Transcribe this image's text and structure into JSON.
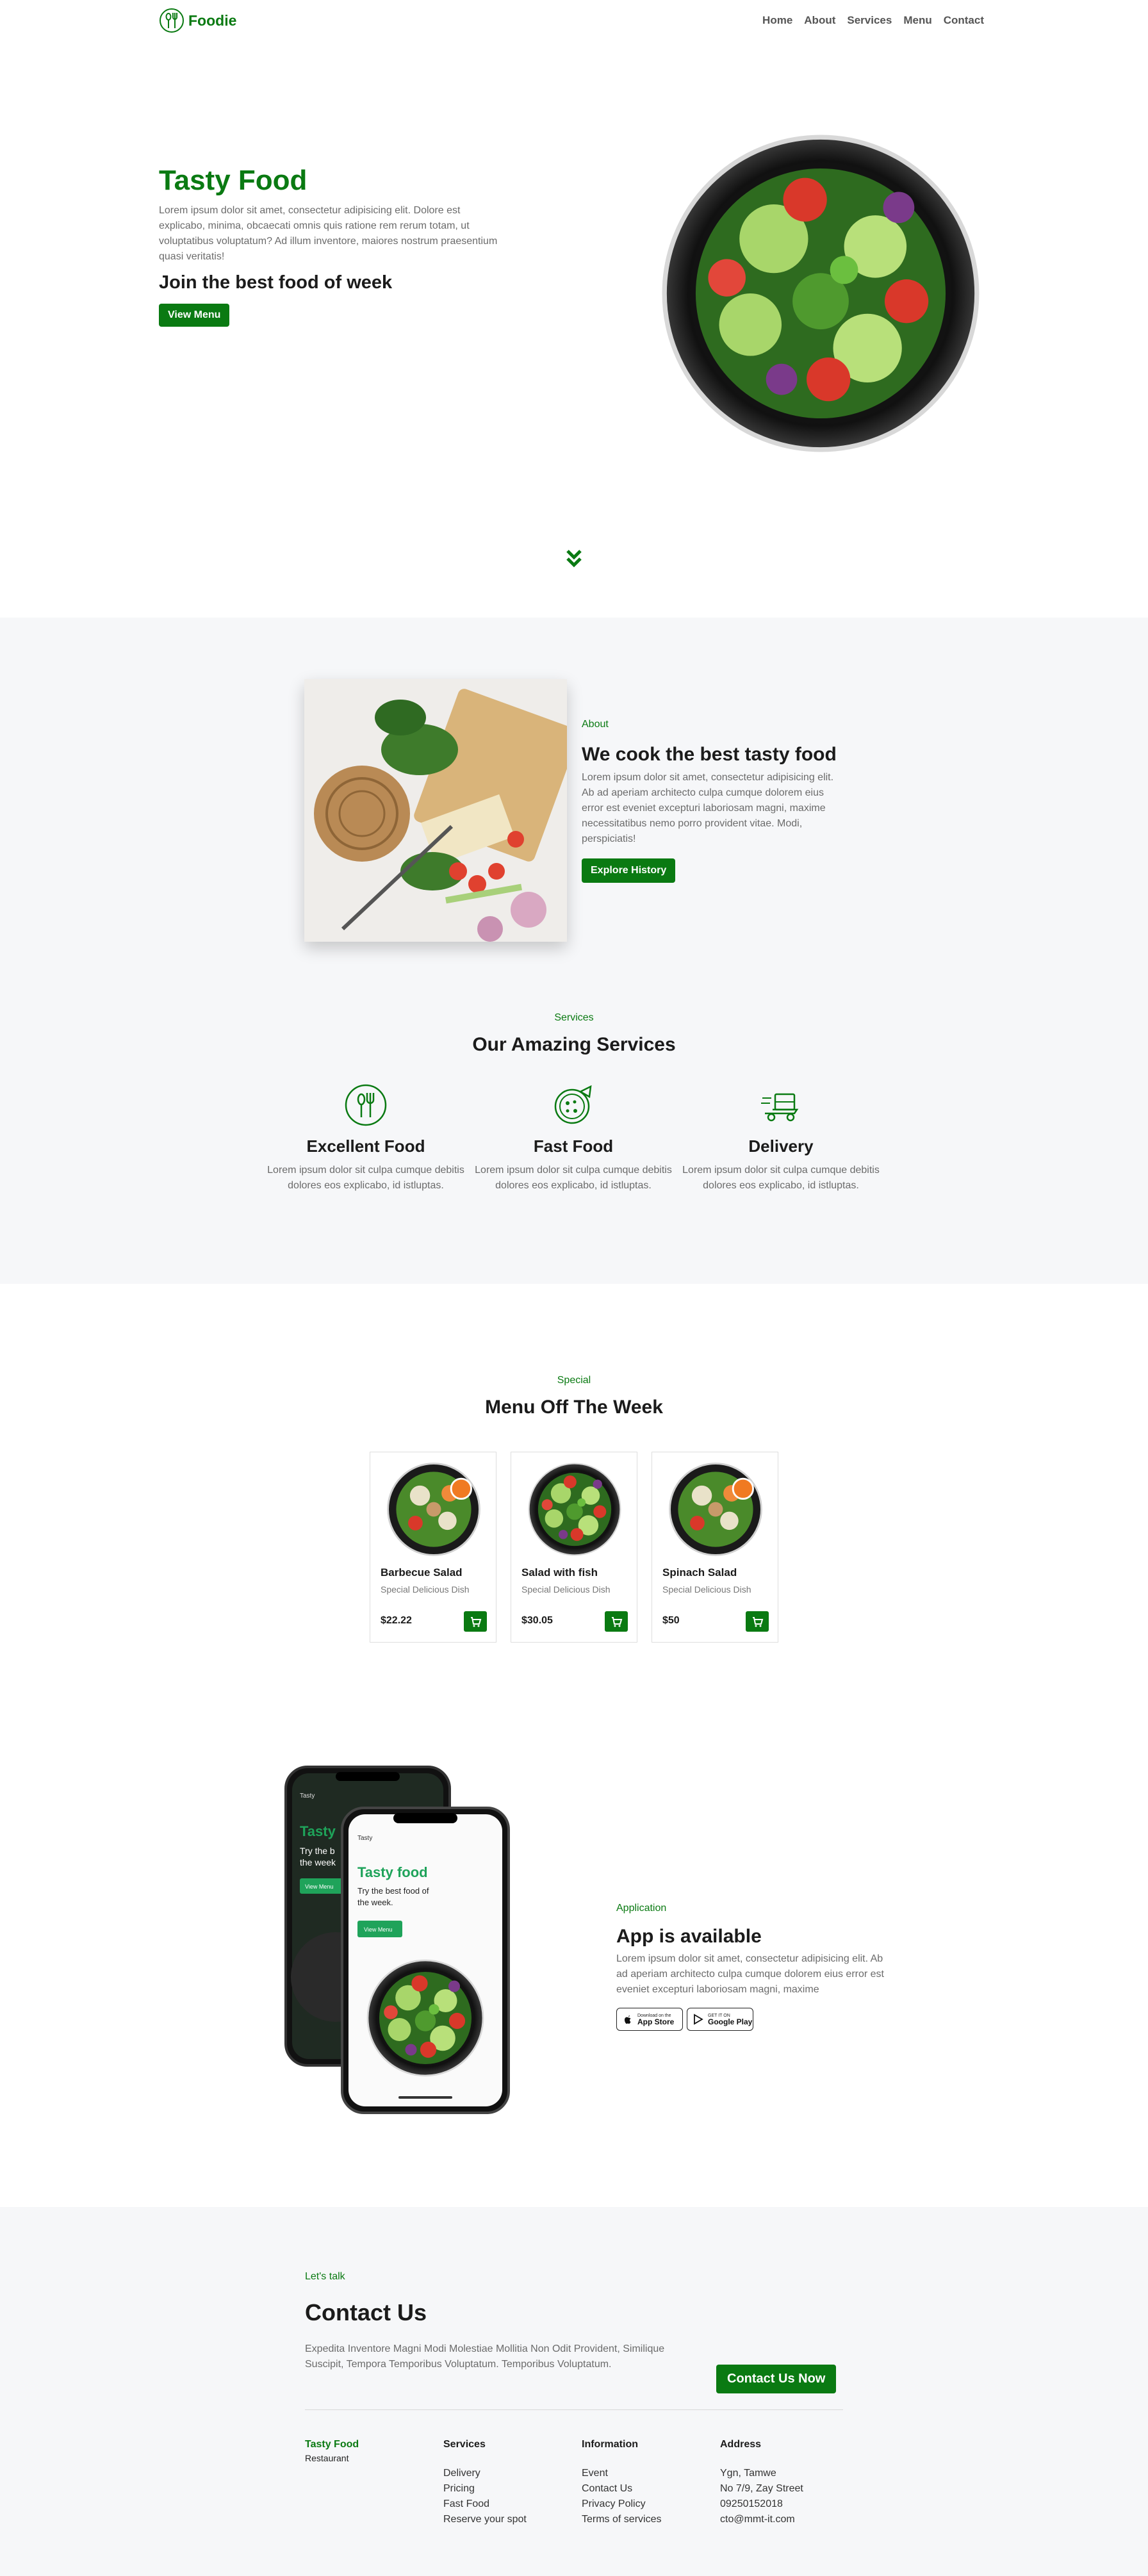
{
  "nav": {
    "brand": "Foodie",
    "links": [
      "Home",
      "About",
      "Services",
      "Menu",
      "Contact"
    ]
  },
  "hero": {
    "title": "Tasty Food",
    "description": "Lorem ipsum dolor sit amet, consectetur adipisicing elit. Dolore est explicabo, minima, obcaecati omnis quis ratione rem rerum totam, ut voluptatibus voluptatum? Ad illum inventore, maiores nostrum praesentium quasi veritatis!",
    "subtitle": "Join the best food of week",
    "button": "View Menu"
  },
  "about": {
    "eyebrow": "About",
    "title": "We cook the best tasty food",
    "description": "Lorem ipsum dolor sit amet, consectetur adipisicing elit. Ab ad aperiam architecto culpa cumque dolorem eius error est eveniet excepturi laboriosam magni, maxime necessitatibus nemo porro provident vitae. Modi, perspiciatis!",
    "button": "Explore History"
  },
  "services": {
    "eyebrow": "Services",
    "title": "Our Amazing Services",
    "items": [
      {
        "name": "Excellent Food",
        "icon": "food-icon",
        "description": "Lorem ipsum dolor sit culpa cumque debitis dolores eos explicabo, id istluptas."
      },
      {
        "name": "Fast Food",
        "icon": "pizza-icon",
        "description": "Lorem ipsum dolor sit culpa cumque debitis dolores eos explicabo, id istluptas."
      },
      {
        "name": "Delivery",
        "icon": "delivery-icon",
        "description": "Lorem ipsum dolor sit culpa cumque debitis dolores eos explicabo, id istluptas."
      }
    ]
  },
  "menu": {
    "eyebrow": "Special",
    "title": "Menu Off The Week",
    "items": [
      {
        "name": "Barbecue Salad",
        "subtitle": "Special Delicious Dish",
        "price": "$22.22"
      },
      {
        "name": "Salad with fish",
        "subtitle": "Special Delicious Dish",
        "price": "$30.05"
      },
      {
        "name": "Spinach Salad",
        "subtitle": "Special Delicious Dish",
        "price": "$50"
      }
    ]
  },
  "app": {
    "eyebrow": "Application",
    "title": "App is available",
    "description": "Lorem ipsum dolor sit amet, consectetur adipisicing elit. Ab ad aperiam architecto culpa cumque dolorem eius error est eveniet excepturi laboriosam magni, maxime",
    "app_store_small": "Download on the",
    "app_store": "App Store",
    "google_play_small": "GET IT ON",
    "google_play": "Google Play",
    "phone_brand": "Tasty",
    "phone_title": "Tasty food",
    "phone_text": "Try the best food of the week.",
    "phone_button": "View Menu",
    "phone_back_title": "Tasty",
    "phone_back_text": "Try the b",
    "phone_back_text2": "the week",
    "phone_back_button": "View Menu"
  },
  "contact": {
    "eyebrow": "Let's talk",
    "title": "Contact Us",
    "description": "Expedita Inventore Magni Modi Molestiae Mollitia Non Odit Provident, Similique Suscipit, Tempora Temporibus Voluptatum. Temporibus Voluptatum.",
    "button": "Contact Us Now"
  },
  "footer": {
    "brand": "Tasty Food",
    "tagline": "Restaurant",
    "services_title": "Services",
    "services": [
      "Delivery",
      "Pricing",
      "Fast Food",
      "Reserve your spot"
    ],
    "info_title": "Information",
    "info": [
      "Event",
      "Contact Us",
      "Privacy Policy",
      "Terms of services"
    ],
    "address_title": "Address",
    "address": [
      "Ygn, Tamwe",
      "No 7/9, Zay Street",
      "09250152018",
      "cto@mmt-it.com"
    ]
  },
  "colors": {
    "accent": "#0a7a12",
    "section_bg": "#f6f7f9"
  }
}
